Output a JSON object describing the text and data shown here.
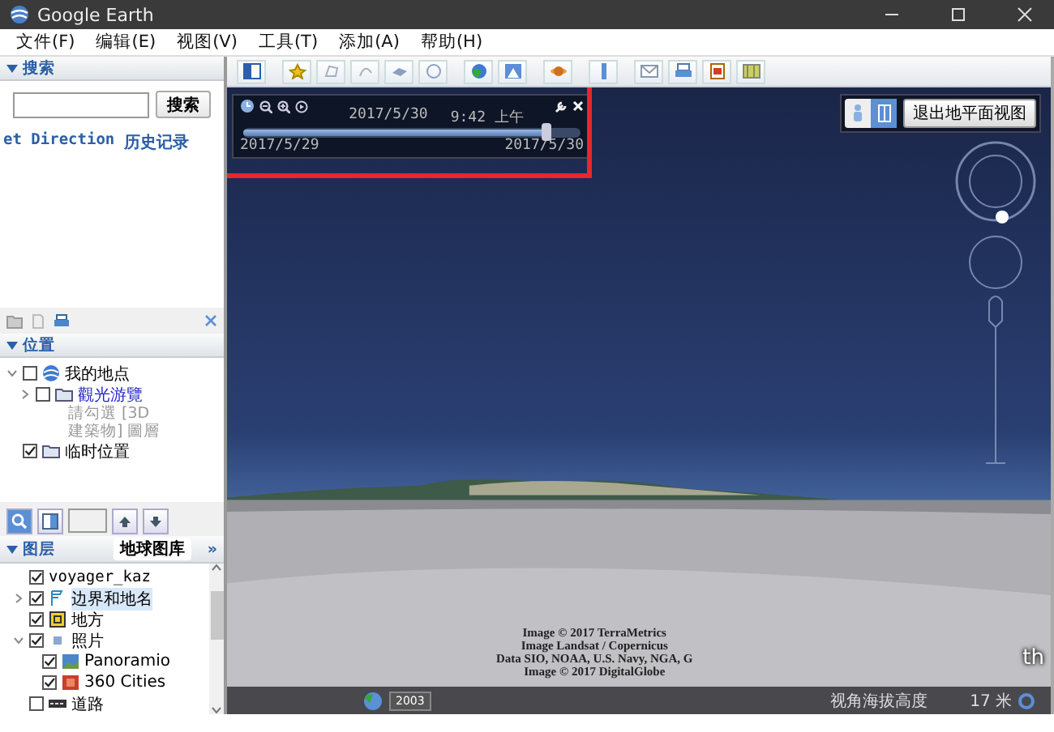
{
  "window": {
    "title": "Google Earth"
  },
  "menu": [
    "文件(F)",
    "编辑(E)",
    "视图(V)",
    "工具(T)",
    "添加(A)",
    "帮助(H)"
  ],
  "search_panel": {
    "title": "搜索",
    "expanded": true,
    "button": "搜索",
    "links": [
      "et Direction",
      "历史记录"
    ]
  },
  "places_panel": {
    "title": "位置",
    "expanded": true,
    "tree": [
      {
        "label": "我的地点",
        "checked": false,
        "expanded": true,
        "kind": "globe",
        "children": [
          {
            "label": "觀光游覽",
            "checked": false,
            "expanded": false,
            "kind": "folder",
            "link": true,
            "note": "請勾選 [3D 建築物] 圖層"
          }
        ]
      },
      {
        "label": "临时位置",
        "checked": true,
        "kind": "folder"
      }
    ]
  },
  "layers_panel": {
    "title": "图层",
    "expanded": true,
    "gallery_button": "地球图库",
    "more": "»",
    "items": [
      {
        "label": "voyager_kaz",
        "checked": true,
        "selected": false
      },
      {
        "label": "边界和地名",
        "checked": true,
        "selected": true,
        "expanded": false,
        "kind": "flag"
      },
      {
        "label": "地方",
        "checked": true,
        "selected": false,
        "kind": "place"
      },
      {
        "label": "照片",
        "checked": true,
        "selected": false,
        "expanded": true,
        "kind": "photo",
        "children": [
          {
            "label": "Panoramio",
            "checked": true,
            "selected": false,
            "kind": "panorama"
          },
          {
            "label": "360 Cities",
            "checked": true,
            "selected": false,
            "kind": "cities"
          }
        ]
      },
      {
        "label": "道路",
        "checked": false,
        "selected": false,
        "kind": "road"
      }
    ]
  },
  "time_slider": {
    "current_date": "2017/5/30",
    "current_time": "9:42 上午",
    "start": "2017/5/29",
    "end": "2017/5/30",
    "level": 0.9
  },
  "view": {
    "exit_ground_button": "退出地平面视图",
    "attributions": [
      "Image © 2017 TerraMetrics",
      "Image Landsat / Copernicus",
      "Data SIO, NOAA, U.S. Navy, NGA, G",
      "Image © 2017 DigitalGlobe"
    ],
    "logo_fragment": "th",
    "imagery_year": "2003",
    "status_label": "视角海拔高度",
    "status_value": "17 米"
  }
}
